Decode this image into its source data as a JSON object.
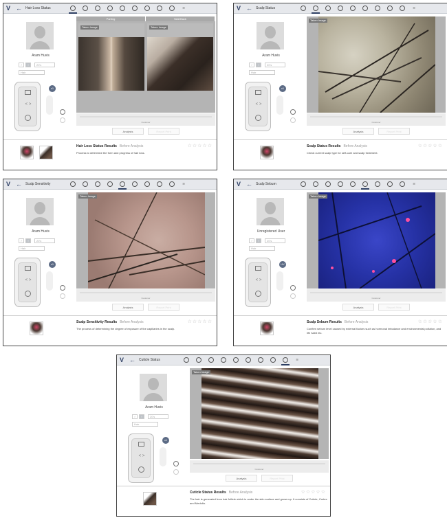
{
  "panels": [
    {
      "title": "Hair Loss Status",
      "active_tab": 0,
      "user": "Aram Huvis",
      "gender_male": "♂",
      "gender_female": "♀",
      "age_placeholder": "20's",
      "area_placeholder": "Hair",
      "image_headers": [
        "Parting",
        "Side/Back"
      ],
      "image_label": "Taken Image",
      "slider_caption": "Customer",
      "btn_analysis": "Analysis",
      "btn_second": "Report Print",
      "result_title": "Hair Loss Status Results",
      "result_status": "Before Analysis",
      "result_desc": "Process to determine the form and progress of hair loss.",
      "stars": "☆☆☆☆☆",
      "magnifier": "x1"
    },
    {
      "title": "Scalp Status",
      "active_tab": 1,
      "user": "Aram Huvis",
      "gender_male": "♂",
      "gender_female": "♀",
      "age_placeholder": "20's",
      "area_placeholder": "Hair",
      "image_label": "Taken Image",
      "slider_caption": "Customer",
      "btn_analysis": "Analysis",
      "btn_second": "Report Print",
      "result_title": "Scalp Status Results",
      "result_status": "Before Analysis",
      "result_desc": "Check current scalp type for self-care and scalp treatment.",
      "stars": "☆☆☆☆☆",
      "magnifier": "x1"
    },
    {
      "title": "Scalp Sensitivity",
      "active_tab": 4,
      "user": "Aram Huvis",
      "gender_male": "♂",
      "gender_female": "♀",
      "age_placeholder": "20's",
      "area_placeholder": "Hair",
      "image_label": "Taken Image",
      "slider_caption": "Customer",
      "btn_analysis": "Analysis",
      "btn_second": "Report Print",
      "result_title": "Scalp Sensitivity Results",
      "result_status": "Before Analysis",
      "result_desc": "The process of determining the degree of exposure of the capillaries in the scalp.",
      "stars": "☆☆☆☆☆",
      "magnifier": "x1"
    },
    {
      "title": "Scalp Sebum",
      "active_tab": 5,
      "user": "Unregistered User",
      "gender_male": "♂",
      "gender_female": "♀",
      "age_placeholder": "20's",
      "area_placeholder": "Hair",
      "image_label": "Taken Image",
      "slider_caption": "Customer",
      "btn_analysis": "Analysis",
      "btn_second": "Report Print",
      "result_title": "Scalp Sebum Results",
      "result_status": "Before Analysis",
      "result_desc": "Confirm sebum level caused by external factors such as hormonal imbalance and environmental pollution, and life habit etc.",
      "stars": "☆☆☆☆☆",
      "magnifier": "UV"
    },
    {
      "title": "Cuticle Status",
      "active_tab": 8,
      "user": "Aram Huvis",
      "gender_male": "♂",
      "gender_female": "♀",
      "age_placeholder": "20's",
      "area_placeholder": "Hair",
      "image_label": "Taken Image",
      "slider_caption": "Customer",
      "btn_analysis": "Analysis",
      "btn_second": "Report Print",
      "result_title": "Cuticle Status Results",
      "result_status": "Before Analysis",
      "result_desc": "The hair is generated from hair follicle which is under the skin surface and grows up. It consists of Cuticle, Cortex and Medulla.",
      "stars": "☆☆☆☆☆",
      "magnifier": "x1"
    }
  ],
  "ui": {
    "logo": "V",
    "back": "←",
    "last_icon": "≋",
    "arrows": "< >"
  }
}
